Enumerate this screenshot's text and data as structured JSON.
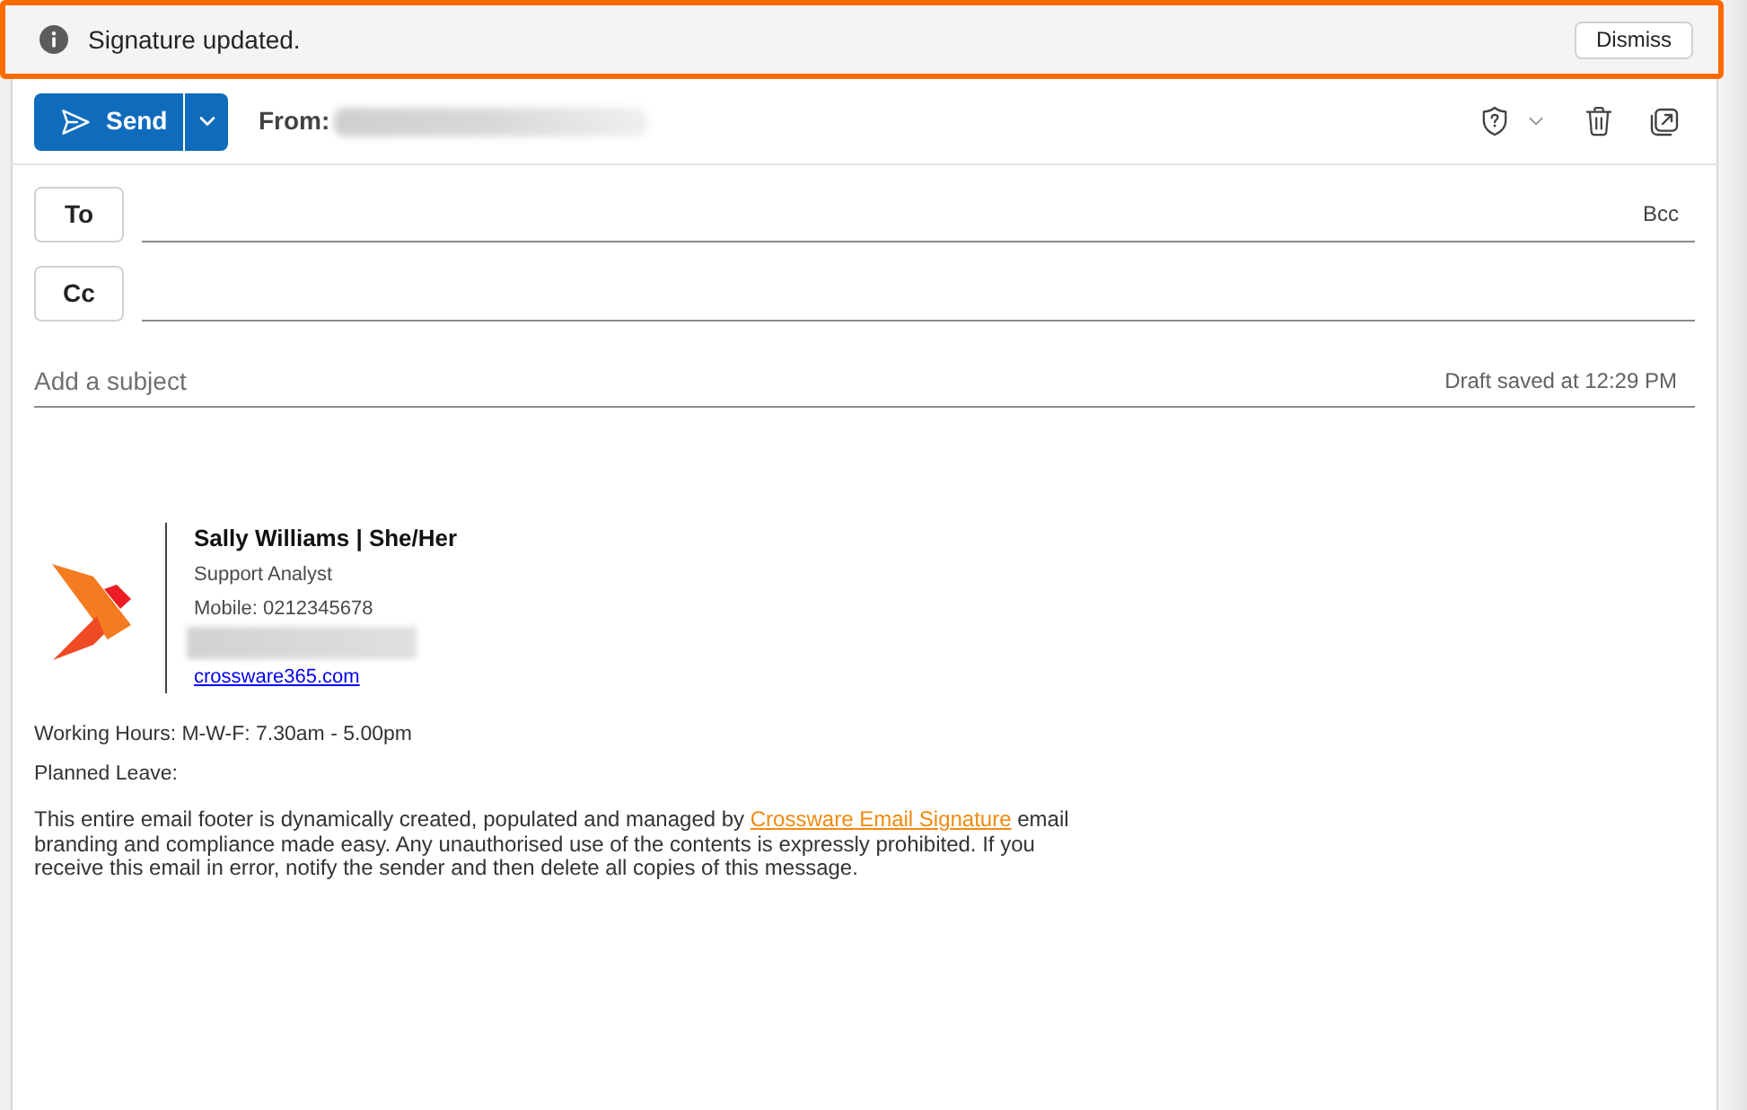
{
  "notification": {
    "message": "Signature updated.",
    "action": "Dismiss"
  },
  "toolbar": {
    "send_label": "Send",
    "from_label": "From:"
  },
  "recipients": [
    {
      "label": "To",
      "trailing": "Bcc"
    },
    {
      "label": "Cc"
    }
  ],
  "subject": {
    "placeholder": "Add a subject",
    "status": "Draft saved at 12:29 PM"
  },
  "signature": {
    "name": "Sally Williams | She/Her",
    "title": "Support Analyst",
    "mobile": "Mobile: 0212345678",
    "website": "crossware365.com"
  },
  "footer": {
    "working_hours": "Working Hours: M-W-F: 7.30am - 5.00pm",
    "planned_leave": "Planned Leave:",
    "disclaimer": {
      "before": "This entire email footer is dynamically created, populated and managed by ",
      "link": "Crossware Email Signature",
      "after": " email branding and compliance made easy. Any unauthorised use of the contents is expressly prohibited. If you receive this email in error, notify the sender and then delete all copies of this message."
    }
  }
}
